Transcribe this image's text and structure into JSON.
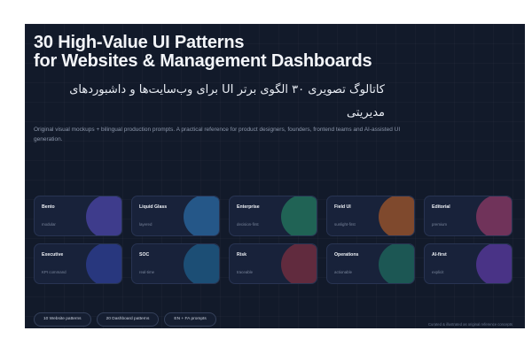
{
  "header": {
    "title_line1": "30 High-Value UI Patterns",
    "title_line2": "for Websites & Management Dashboards",
    "title_fa": "کاتالوگ تصویری ۳۰ الگوی برتر UI برای وب‌سایت‌ها و داشبوردهای مدیریتی",
    "subtitle": "Original visual mockups + bilingual production prompts. A practical reference for product designers, founders, frontend teams and AI-assisted UI generation."
  },
  "cards": [
    {
      "label": "Bento",
      "meta": "modular",
      "accent": "#4b45a8"
    },
    {
      "label": "Liquid Glass",
      "meta": "layered",
      "accent": "#2a6aa3"
    },
    {
      "label": "Enterprise",
      "meta": "decision-first",
      "accent": "#237a5f"
    },
    {
      "label": "Field UI",
      "meta": "sunlight-first",
      "accent": "#a1572a"
    },
    {
      "label": "Editorial",
      "meta": "premium",
      "accent": "#8e3a66"
    },
    {
      "label": "Executive",
      "meta": "KPI command",
      "accent": "#2d3f96"
    },
    {
      "label": "SOC",
      "meta": "real-time",
      "accent": "#1d5e8a"
    },
    {
      "label": "Risk",
      "meta": "traceable",
      "accent": "#7a2f40"
    },
    {
      "label": "Operations",
      "meta": "actionable",
      "accent": "#1d6a5e"
    },
    {
      "label": "AI-first",
      "meta": "explicit",
      "accent": "#5a3aa0"
    }
  ],
  "pills": [
    "10 Website patterns",
    "20 Dashboard patterns",
    "EN + FA prompts"
  ],
  "footnote": "Curated & illustrated as original reference concepts",
  "colors": {
    "background": "#121a2a",
    "card": "#18223a",
    "card_border": "#283452",
    "text_primary": "#f3f5f9",
    "text_muted": "#8c97ab"
  }
}
